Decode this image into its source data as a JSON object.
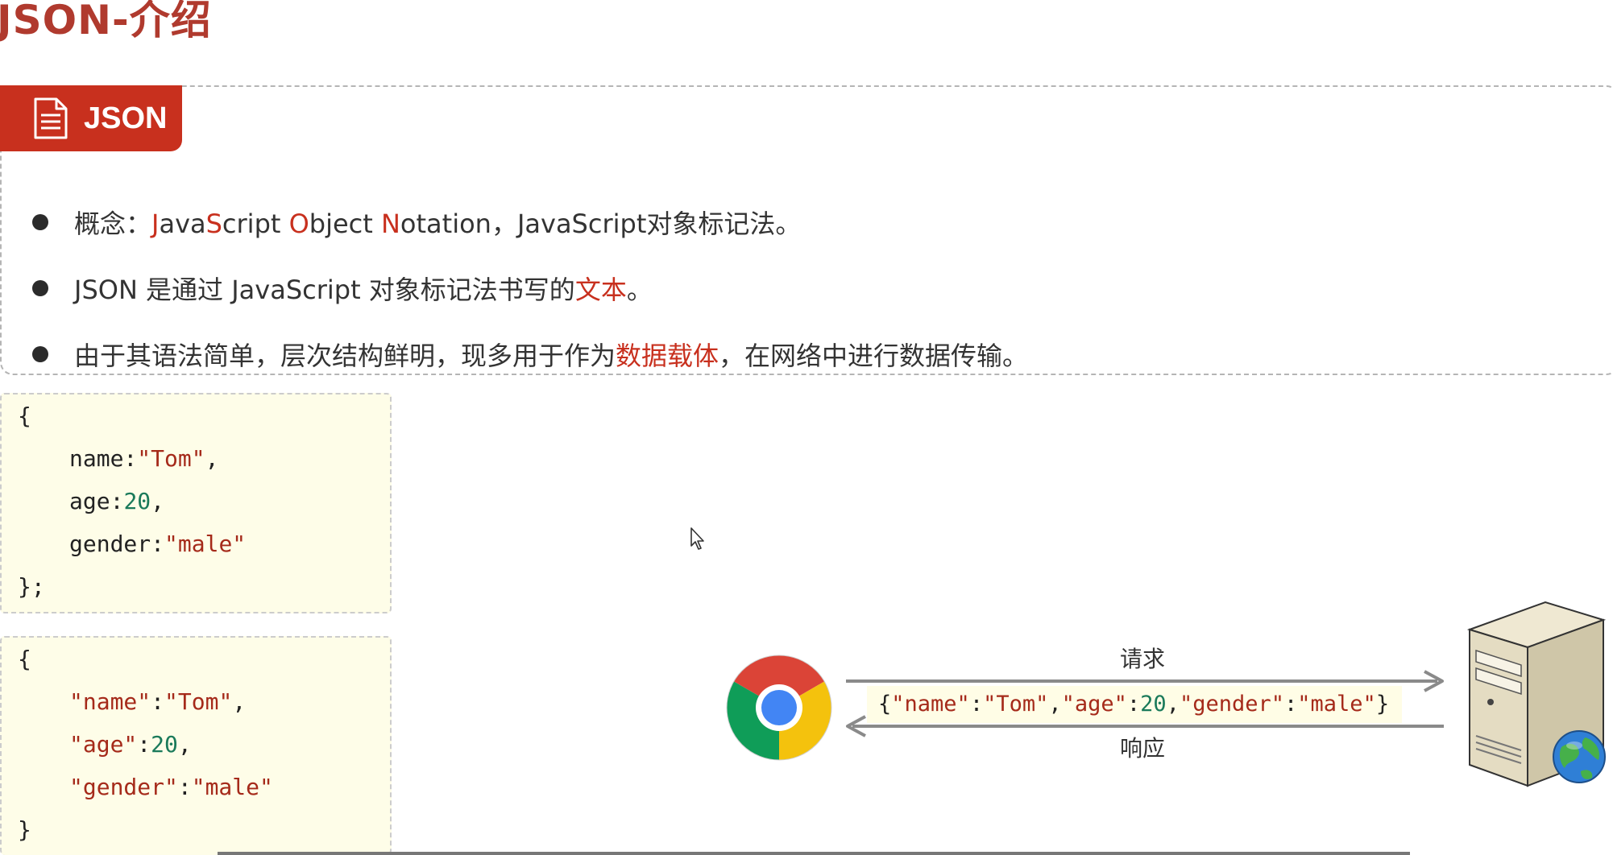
{
  "page": {
    "title": "JSON-介绍"
  },
  "section": {
    "tag_label": "JSON",
    "tag_icon": "document-icon"
  },
  "bullets": [
    {
      "parts": [
        {
          "text": "概念：",
          "red": false
        },
        {
          "text": "J",
          "red": true
        },
        {
          "text": "ava",
          "red": false
        },
        {
          "text": "S",
          "red": true
        },
        {
          "text": "cript ",
          "red": false
        },
        {
          "text": "O",
          "red": true
        },
        {
          "text": "bject ",
          "red": false
        },
        {
          "text": "N",
          "red": true
        },
        {
          "text": "otation，JavaScript对象标记法。",
          "red": false
        }
      ]
    },
    {
      "parts": [
        {
          "text": "JSON 是通过 JavaScript 对象标记法书写的",
          "red": false
        },
        {
          "text": "文本",
          "red": true
        },
        {
          "text": "。",
          "red": false
        }
      ]
    },
    {
      "parts": [
        {
          "text": "由于其语法简单，层次结构鲜明，现多用于作为",
          "red": false
        },
        {
          "text": "数据载体",
          "red": true
        },
        {
          "text": "，在网络中进行数据传输。",
          "red": false
        }
      ]
    }
  ],
  "code_js_object": {
    "open": "{",
    "name_key": "name:",
    "name_val": "\"Tom\"",
    "name_comma": ",",
    "age_key": "age:",
    "age_val": "20",
    "age_comma": ",",
    "gender_key": "gender:",
    "gender_val": "\"male\"",
    "close": "};"
  },
  "code_json": {
    "open": "{",
    "name_key": "\"name\"",
    "name_colon": ":",
    "name_val": "\"Tom\"",
    "name_comma": ",",
    "age_key": "\"age\"",
    "age_colon": ":",
    "age_val": "20",
    "age_comma": ",",
    "gender_key": "\"gender\"",
    "gender_colon": ":",
    "gender_val": "\"male\"",
    "close": "}"
  },
  "diagram": {
    "request_label": "请求",
    "response_label": "响应",
    "json_string": {
      "p1": "{",
      "k1": "\"name\"",
      "c1": ":",
      "v1": "\"Tom\"",
      "s1": ",",
      "k2": "\"age\"",
      "c2": ":",
      "v2": "20",
      "s2": ",",
      "k3": "\"gender\"",
      "c3": ":",
      "v3": "\"male\"",
      "p2": "}"
    },
    "browser_icon": "chrome-icon",
    "server_icon": "server-icon"
  },
  "colors": {
    "accent_red": "#c8301e",
    "title_red": "#b03a2e",
    "string_color": "#a52a1a",
    "number_color": "#1a7a5a",
    "code_bg": "#fefde8"
  }
}
